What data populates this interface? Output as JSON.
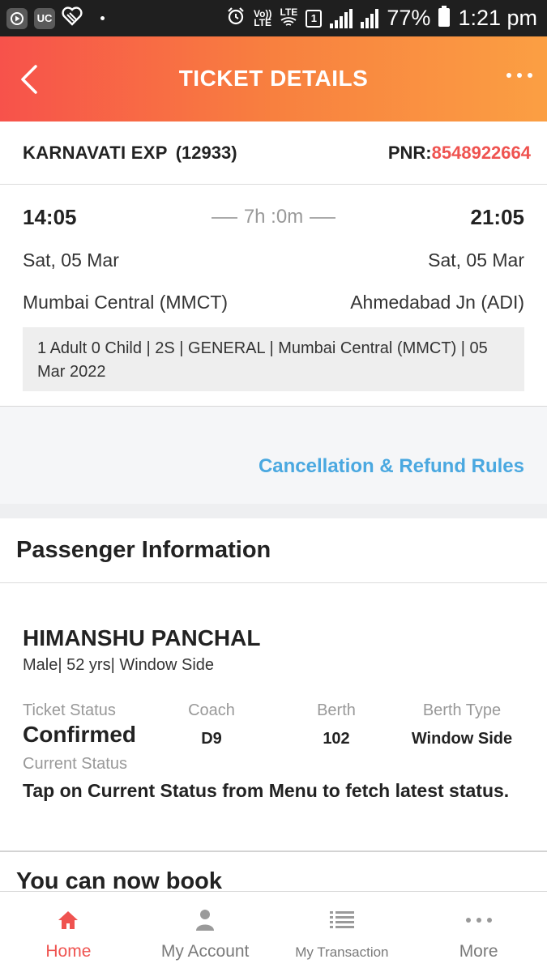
{
  "status_bar": {
    "uc_label": "UC",
    "volte": "Vo))\nLTE",
    "lte": "LTE",
    "sim": "1",
    "battery": "77%",
    "time": "1:21 pm"
  },
  "header": {
    "title": "TICKET DETAILS"
  },
  "train": {
    "name": "KARNAVATI EXP",
    "number": "(12933)",
    "pnr_label": "PNR:",
    "pnr_value": "8548922664"
  },
  "journey": {
    "departure_time": "14:05",
    "arrival_time": "21:05",
    "duration": "7h :0m",
    "departure_date": "Sat, 05 Mar",
    "arrival_date": "Sat, 05 Mar",
    "from_station": "Mumbai Central (MMCT)",
    "to_station": "Ahmedabad Jn (ADI)",
    "summary": "1 Adult 0 Child  | 2S | GENERAL | Mumbai Central (MMCT) | 05 Mar 2022"
  },
  "cancellation_link": "Cancellation & Refund Rules",
  "passenger_section_title": "Passenger Information",
  "passenger": {
    "name": "HIMANSHU PANCHAL",
    "meta": "Male| 52 yrs| Window Side",
    "ticket_status_label": "Ticket Status",
    "ticket_status": "Confirmed",
    "coach_label": "Coach",
    "coach": "D9",
    "berth_label": "Berth",
    "berth": "102",
    "berth_type_label": "Berth Type",
    "berth_type": "Window Side",
    "current_status_label": "Current Status",
    "current_status": "Tap on Current Status from Menu to fetch latest status."
  },
  "promo_text": "You can now book",
  "bottom_nav": {
    "home": "Home",
    "account": "My Account",
    "transaction": "My Transaction",
    "more": "More"
  },
  "colors": {
    "accent_red": "#ef5350",
    "link_blue": "#4aa8e0",
    "header_gradient_start": "#f7524b",
    "header_gradient_end": "#fb9f43"
  }
}
